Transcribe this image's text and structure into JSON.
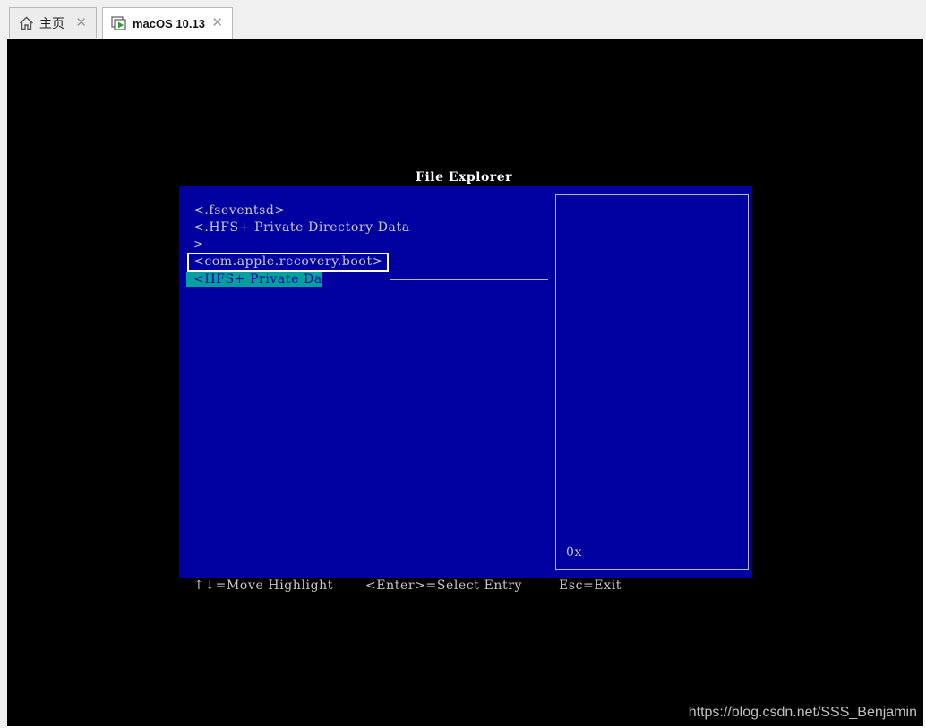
{
  "tabs": [
    {
      "label": "主页",
      "icon": "home-icon",
      "active": false
    },
    {
      "label": "macOS 10.13",
      "icon": "vm-running-icon",
      "active": true
    }
  ],
  "vm": {
    "screen_title": "File Explorer",
    "entries": [
      "<.fseventsd>",
      "<.HFS+ Private Directory Data",
      ">",
      "<com.apple.recovery.boot>",
      "<HFS+ Private Data>"
    ],
    "selected_index": 4,
    "annotated_index": 3,
    "side_value": "0x",
    "help": {
      "move": "↑↓=Move Highlight",
      "select": "<Enter>=Select Entry",
      "exit": "Esc=Exit"
    }
  },
  "watermark": "https://blog.csdn.net/SSS_Benjamin",
  "colors": {
    "panel_bg": "#0000a0",
    "highlight_bg": "#00a0a0",
    "screen_bg": "#000000"
  }
}
